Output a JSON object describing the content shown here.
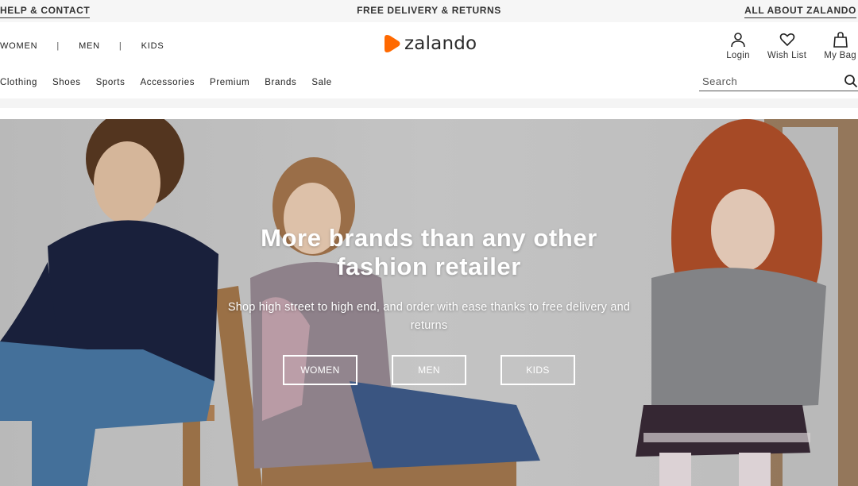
{
  "util_bar": {
    "help_contact": "HELP & CONTACT",
    "free_delivery": "FREE DELIVERY & RETURNS",
    "about": "ALL ABOUT ZALANDO"
  },
  "gender_nav": [
    "WOMEN",
    "MEN",
    "KIDS"
  ],
  "gender_separator": "|",
  "logo": {
    "text": "zalando",
    "brand_color": "#ff6900"
  },
  "account": {
    "login": "Login",
    "wishlist": "Wish List",
    "bag": "My Bag"
  },
  "category_nav": [
    "Clothing",
    "Shoes",
    "Sports",
    "Accessories",
    "Premium",
    "Brands",
    "Sale"
  ],
  "search": {
    "placeholder": "Search",
    "icon": "search-icon"
  },
  "hero": {
    "title_line1": "More brands than any other",
    "title_line2": "fashion retailer",
    "subtitle": "Shop high street to high end, and order with ease thanks to free delivery and returns",
    "ctas": [
      "WOMEN",
      "MEN",
      "KIDS"
    ]
  },
  "colors": {
    "accent": "#ff6900",
    "text": "#1a1a1a",
    "hero_overlay_text": "#ffffff"
  }
}
